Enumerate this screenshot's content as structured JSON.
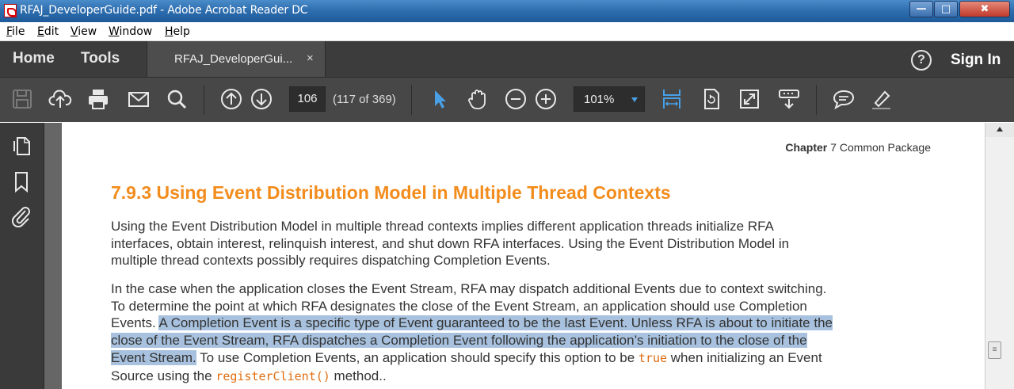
{
  "window": {
    "title": "RFAJ_DeveloperGuide.pdf - Adobe Acrobat Reader DC",
    "minimize": "—",
    "maximize": "□",
    "close": "✖"
  },
  "menu": {
    "items": [
      {
        "first": "F",
        "rest": "ile"
      },
      {
        "first": "E",
        "rest": "dit"
      },
      {
        "first": "V",
        "rest": "iew"
      },
      {
        "first": "W",
        "rest": "indow"
      },
      {
        "first": "H",
        "rest": "elp"
      }
    ]
  },
  "nav": {
    "home": "Home",
    "tools": "Tools",
    "doc_tab": "RFAJ_DeveloperGui...",
    "doc_tab_close": "×",
    "help": "?",
    "sign_in": "Sign In"
  },
  "toolbar": {
    "page_number": "106",
    "page_count": "(117 of 369)",
    "zoom": "101%",
    "icons": [
      "save-icon",
      "upload-icon",
      "print-icon",
      "email-icon",
      "search-icon",
      "page-up-icon",
      "page-down-icon",
      "select-arrow-icon",
      "hand-icon",
      "zoom-out-icon",
      "zoom-in-icon",
      "fit-width-icon",
      "rotate-icon",
      "fullscreen-icon",
      "read-mode-icon",
      "comment-icon",
      "highlight-pen-icon"
    ],
    "accent_color": "#49a0e6"
  },
  "leftrail": {
    "icons": [
      "pages-icon",
      "bookmark-icon",
      "attachment-icon"
    ]
  },
  "document": {
    "chapter_label": "Chapter",
    "chapter_text": "7 Common Package",
    "heading": "7.9.3  Using Event Distribution Model in Multiple Thread Contexts",
    "heading_color": "#f28c1d",
    "para1": [
      "Using the Event Distribution Model in multiple thread contexts implies different application threads initialize RFA",
      "interfaces, obtain interest, relinquish interest, and shut down RFA interfaces. Using the Event Distribution Model in",
      "multiple thread contexts possibly requires dispatching Completion Events."
    ],
    "para2": {
      "l1": "In the case when the application closes the Event Stream, RFA may dispatch additional Events due to context switching.",
      "l2": "To determine the point at which RFA designates the close of the Event Stream, an application should use Completion",
      "l3_plain": "Events. ",
      "l3_hl": "A Completion Event is a specific type of Event guaranteed to be the last Event. Unless RFA is about to initiate the",
      "l4_hl": "close of the Event Stream, RFA dispatches a Completion Event following the application’s initiation to the close of the",
      "l5_hl": "Event Stream.",
      "l5_a": " To use Completion Events, an application should specify this option to be ",
      "l5_code": "true",
      "l5_b": " when initializing an Event",
      "l6_a": "Source using the ",
      "l6_code": "registerClient()",
      "l6_b": " method.."
    },
    "highlight_color": "#a7c1de"
  }
}
